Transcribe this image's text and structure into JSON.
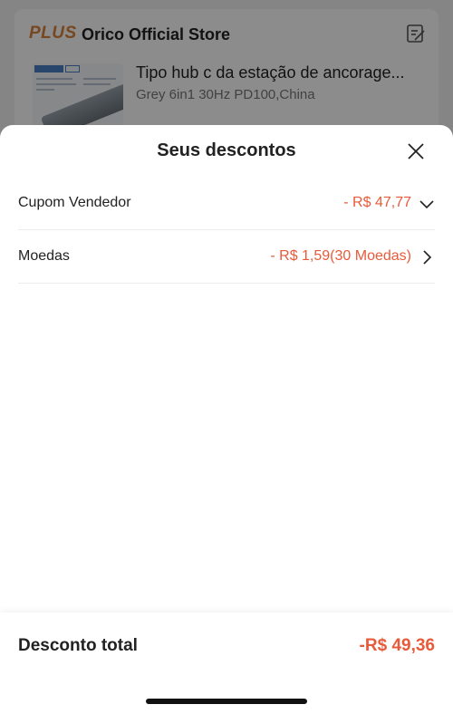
{
  "background": {
    "store": {
      "badge": "PLUS",
      "name": "Orico Official Store"
    },
    "product": {
      "title": "Tipo hub c da estação de ancorage...",
      "variant": "Grey 6in1 30Hz PD100,China"
    }
  },
  "sheet": {
    "title": "Seus descontos",
    "rows": [
      {
        "label": "Cupom Vendedor",
        "value": "- R$ 47,77",
        "icon": "chevron-down-icon"
      },
      {
        "label": "Moedas",
        "value": "- R$ 1,59(30 Moedas)",
        "icon": "chevron-right-icon"
      }
    ],
    "footer": {
      "total_label": "Desconto total",
      "total_value": "-R$ 49,36"
    }
  },
  "colors": {
    "accent": "#e85a3a",
    "plus_badge": "#d9823a",
    "overlay": "rgba(0,0,0,0.45)"
  }
}
